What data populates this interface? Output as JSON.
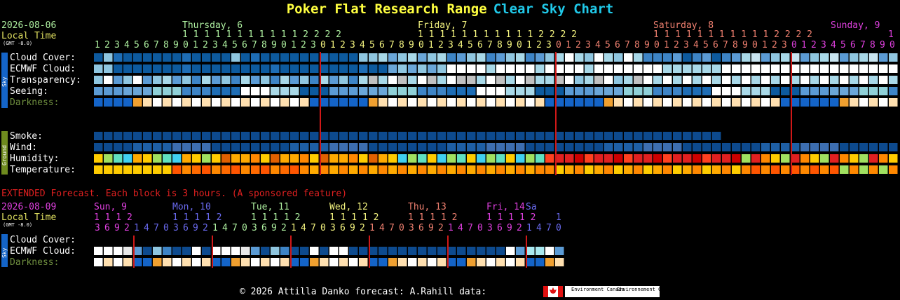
{
  "header": {
    "title_part1": "Poker Flat Research Range",
    "title_part2": "Clear Sky Chart"
  },
  "left_info": {
    "date": "2026-08-06",
    "local_time": "Local Time",
    "gmt": "(GMT -8.0)",
    "ext_date": "2026-08-09"
  },
  "days": [
    {
      "label": "Thursday, 6",
      "color": "#aef0a0"
    },
    {
      "label": "Friday, 7",
      "color": "#f5f580"
    },
    {
      "label": "Saturday, 8",
      "color": "#f08070"
    },
    {
      "label": "Sunday, 9",
      "color": "#e040e0"
    }
  ],
  "hour_ones": "1 2 3 4 5 6 7 8 9 0 1 2 3 4 5 6 7 8 9 0 1 2 3 0 1 2 3 4 5 6 7 8 9 0 1 2 3 4 5 6 7 8 9 0 1 2 3 0 1 2 3 4 5 6 7 8 9 0 1 2 3 4 5 6 7 8 9 0 1 2 3 0 1 2 3 4 5 6 7 8 9 0",
  "hour_tens": [
    "1 1 1 1 1 1 1 1 1 1 1 2 2 2 2",
    "1 1 1 1 1 1 1 1 1 1 1 2 2 2 2",
    "1 1 1 1 1 1 1 1 1 1 1 2 2 2 2",
    "1"
  ],
  "side": {
    "sky": "Sky",
    "ground": "Ground"
  },
  "rows": {
    "cloud": "Cloud Cover:",
    "ecmwf": "ECMWF Cloud:",
    "transparency": "Transparency:",
    "seeing": "Seeing:",
    "darkness": "Darkness:",
    "smoke": "Smoke:",
    "wind": "Wind:",
    "humidity": "Humidity:",
    "temperature": "Temperature:"
  },
  "extended": {
    "note": "EXTENDED Forecast. Each block is 3 hours. (A sponsored feature)",
    "days": [
      {
        "label": "Sun, 9",
        "color": "#e040e0",
        "tens": "1 1 1 2"
      },
      {
        "label": "Mon, 10",
        "color": "#6a6af0",
        "tens": "1 1 1 1 2"
      },
      {
        "label": "Tue, 11",
        "color": "#aef0a0",
        "tens": "1 1 1 1 2"
      },
      {
        "label": "Wed, 12",
        "color": "#f5f580",
        "tens": "1 1 1 1 2"
      },
      {
        "label": "Thu, 13",
        "color": "#f08070",
        "tens": "1 1 1 1 2"
      },
      {
        "label": "Fri, 14",
        "color": "#e040e0",
        "tens": "1 1 1 1 2"
      },
      {
        "label": "Sa",
        "color": "#6a6af0",
        "tens": "1"
      }
    ],
    "hours": "3 6 9 2 1 4 7 0 3 6 9 2 1 4 7 0 3 6 9 2 1 4 7 0 3 6 9 2 1 4 7 0 3 6 9 2 1 4 7 0 3 6 9 2 1 4 7 0"
  },
  "footer": {
    "text": "© 2026 Attilla Danko  forecast: A.Rahill  data:",
    "logo1": "Environment Canada",
    "logo2": "Environnement Canada"
  },
  "colors": {
    "title1": "#ffff40",
    "title2": "#20c8e8",
    "date": "#aef0a0",
    "local_time": "#e0e060",
    "midnight_line": "#d01818",
    "ext_note": "#e02020"
  }
}
